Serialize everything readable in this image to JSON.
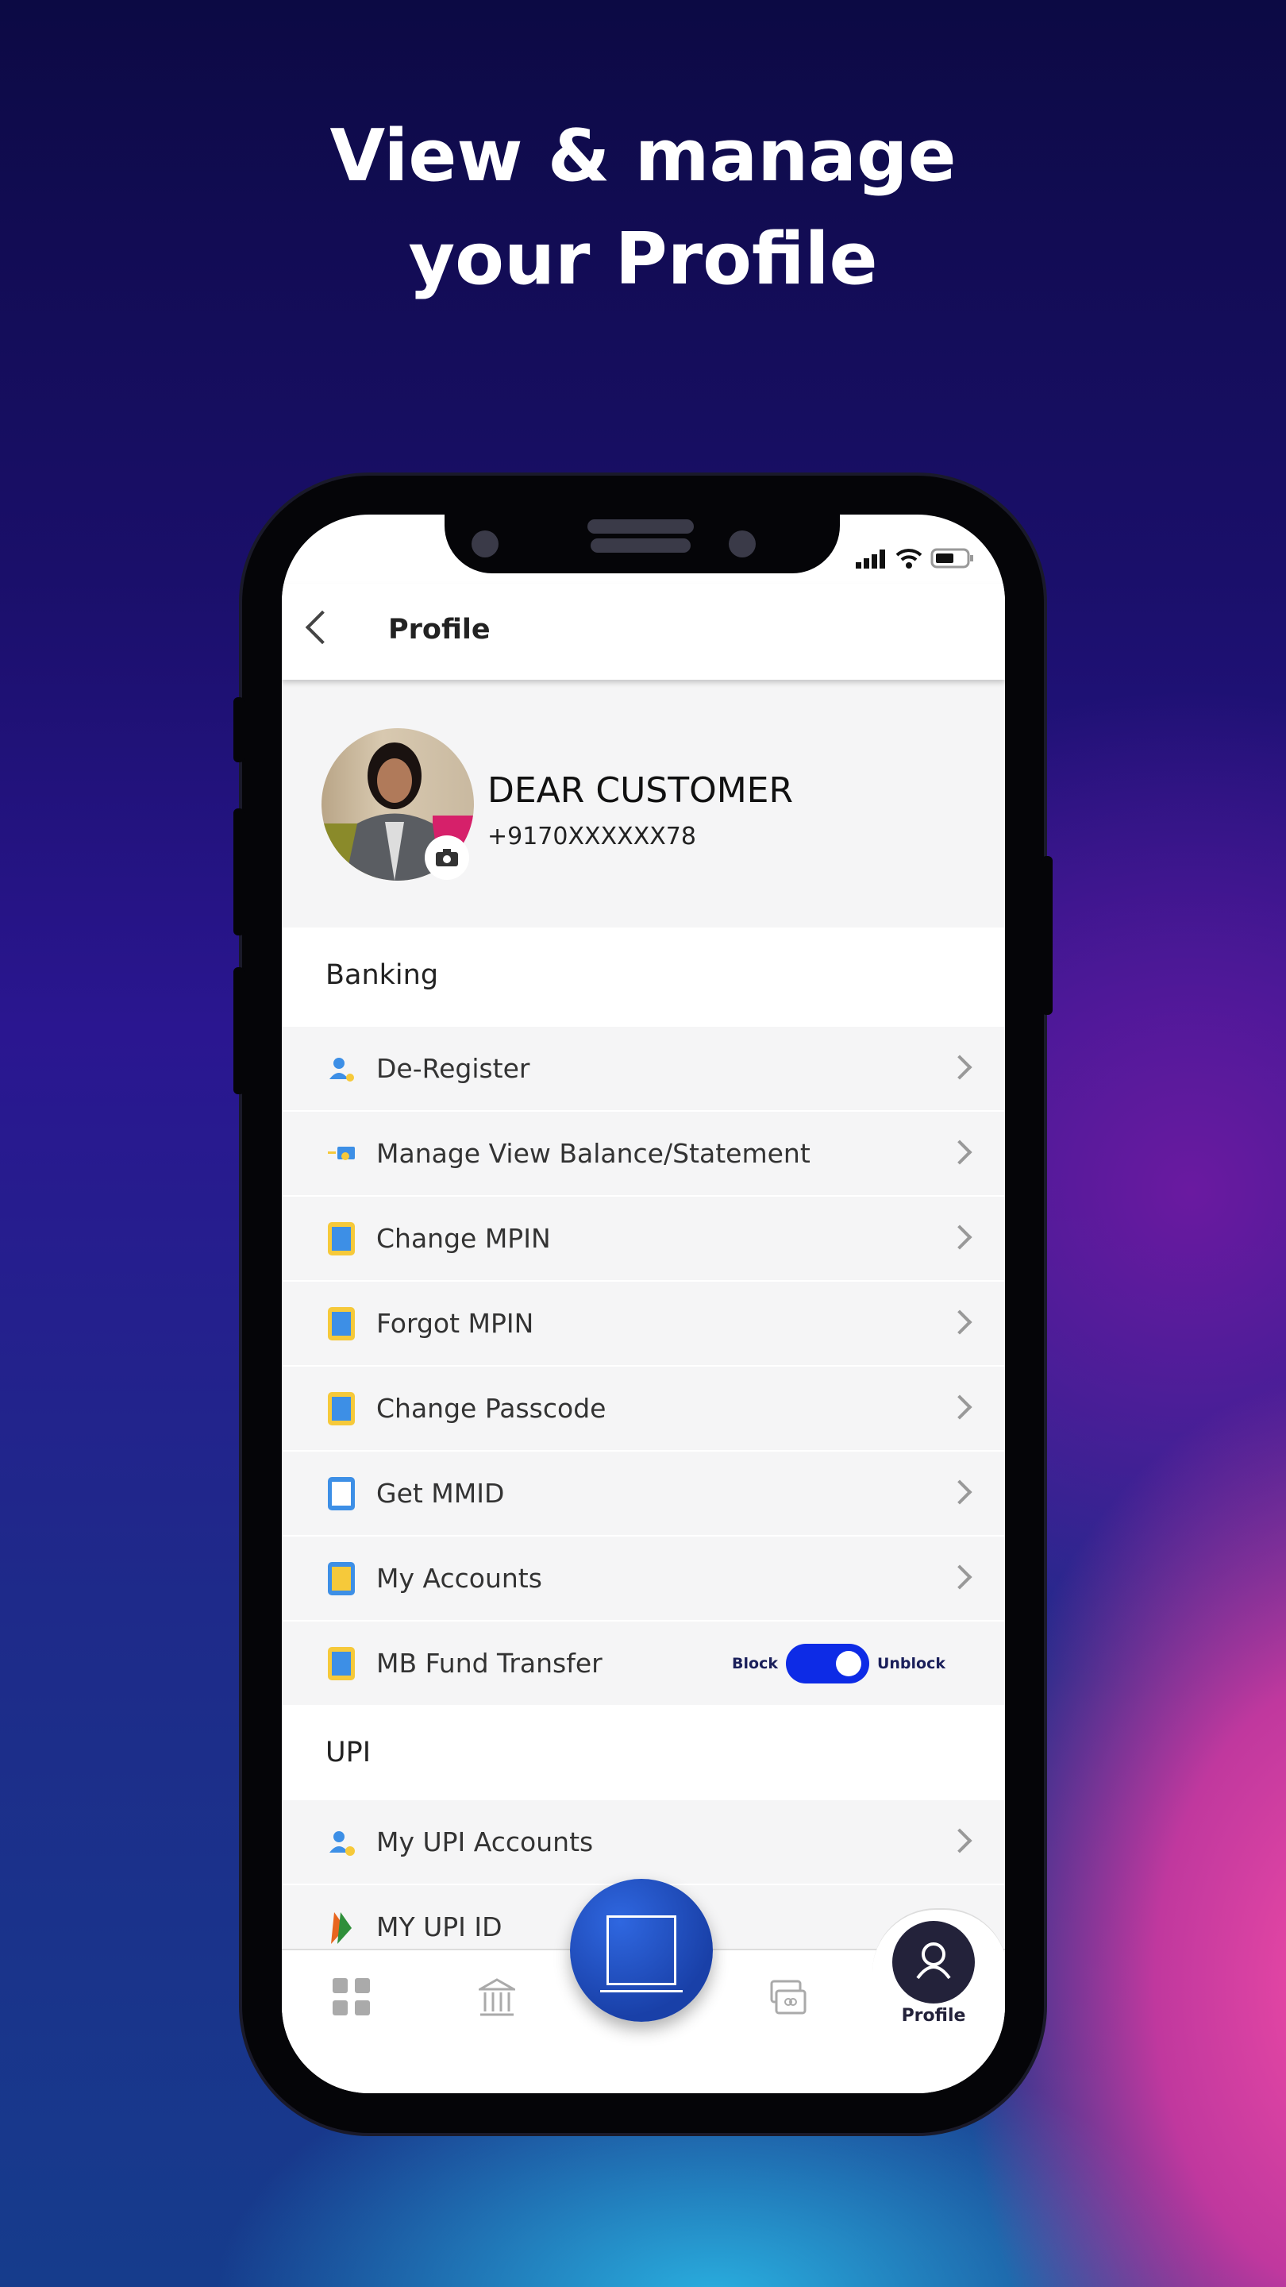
{
  "headline": {
    "line1": "View & manage",
    "line2": "your Profile"
  },
  "header": {
    "title": "Profile"
  },
  "profile": {
    "name": "DEAR CUSTOMER",
    "phone": "+9170XXXXXX78"
  },
  "banking": {
    "title": "Banking",
    "items": [
      {
        "label": "De-Register",
        "icon": "user-remove-icon"
      },
      {
        "label": "Manage View Balance/Statement",
        "icon": "balance-card-icon"
      },
      {
        "label": "Change MPIN",
        "icon": "phone-mpin-icon"
      },
      {
        "label": "Forgot MPIN",
        "icon": "phone-question-icon"
      },
      {
        "label": "Change Passcode",
        "icon": "phone-passcode-icon"
      },
      {
        "label": "Get MMID",
        "icon": "phone-user-icon"
      },
      {
        "label": "My Accounts",
        "icon": "phone-bank-icon"
      },
      {
        "label": "MB Fund Transfer",
        "icon": "phone-block-icon",
        "toggle": {
          "left": "Block",
          "right": "Unblock",
          "state": "on"
        }
      }
    ]
  },
  "upi": {
    "title": "UPI",
    "items": [
      {
        "label": "My UPI Accounts",
        "icon": "upi-user-icon"
      },
      {
        "label": "MY UPI ID",
        "icon": "bhim-upi-icon"
      }
    ]
  },
  "nav": {
    "active": "Profile",
    "profile_label": "Profile"
  },
  "colors": {
    "toggle": "#0d2be6",
    "fab": "#1f4fc4",
    "nav_active": "#23223a"
  }
}
